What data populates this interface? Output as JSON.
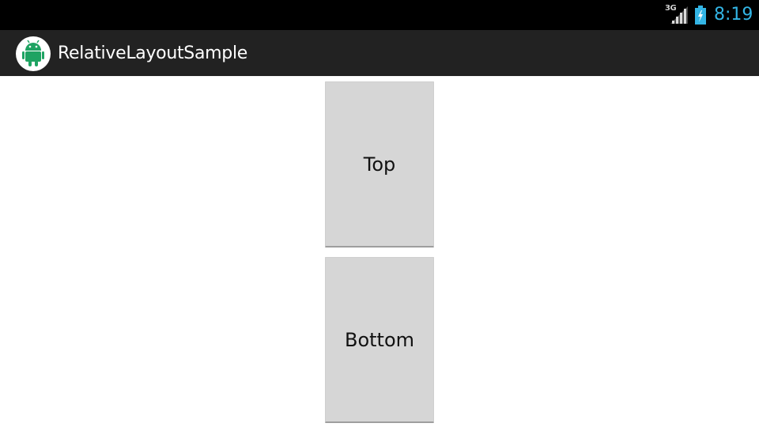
{
  "status_bar": {
    "network_type": "3G",
    "time": "8:19",
    "icons": [
      "signal-icon",
      "battery-charging-icon"
    ],
    "clock_color": "#33b5e5"
  },
  "action_bar": {
    "app_icon": "android-app-icon",
    "title": "RelativeLayoutSample",
    "background": "#222222"
  },
  "content": {
    "buttons": [
      {
        "label": "Top"
      },
      {
        "label": "Bottom"
      }
    ],
    "button_color": "#d6d6d6"
  }
}
